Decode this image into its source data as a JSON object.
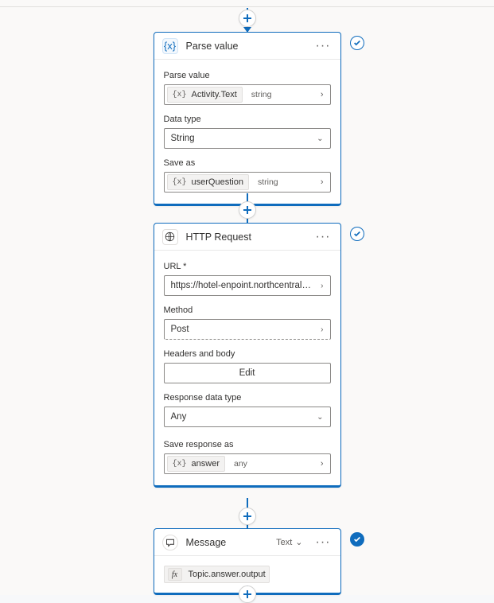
{
  "nodes": {
    "parse": {
      "title": "Parse value",
      "fields": {
        "parse_value_label": "Parse value",
        "parse_value_token": "Activity.Text",
        "parse_value_type": "string",
        "data_type_label": "Data type",
        "data_type_value": "String",
        "save_as_label": "Save as",
        "save_as_token": "userQuestion",
        "save_as_type": "string"
      }
    },
    "http": {
      "title": "HTTP Request",
      "fields": {
        "url_label": "URL *",
        "url_value": "https://hotel-enpoint.northcentralus.inf...",
        "method_label": "Method",
        "method_value": "Post",
        "headers_label": "Headers and body",
        "headers_btn": "Edit",
        "resp_type_label": "Response data type",
        "resp_type_value": "Any",
        "save_resp_label": "Save response as",
        "save_resp_token": "answer",
        "save_resp_type": "any"
      }
    },
    "message": {
      "title": "Message",
      "subtype": "Text",
      "expr": "Topic.answer.output"
    }
  },
  "icons": {
    "fx": "fx",
    "var": "{x}"
  }
}
